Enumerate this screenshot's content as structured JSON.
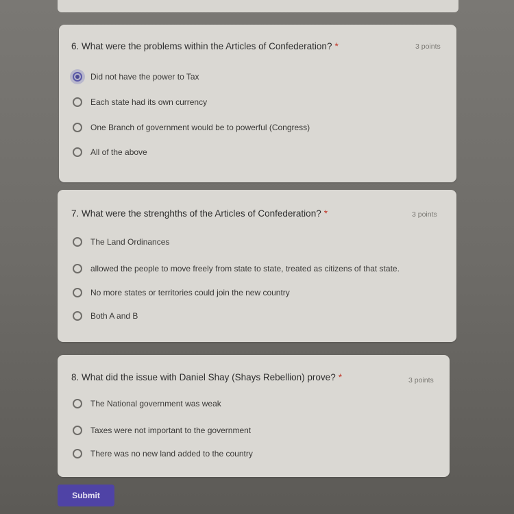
{
  "questions": [
    {
      "title": "6. What were the problems within the Articles of Confederation?",
      "required": "*",
      "points": "3 points",
      "options": [
        {
          "label": "Did not have the power to Tax",
          "checked": true
        },
        {
          "label": "Each state had its own currency",
          "checked": false
        },
        {
          "label": "One Branch of government would be to powerful (Congress)",
          "checked": false
        },
        {
          "label": "All of the above",
          "checked": false
        }
      ]
    },
    {
      "title": "7. What were the strenghths of the Articles of Confederation?",
      "required": "*",
      "points": "3 points",
      "options": [
        {
          "label": "The Land Ordinances",
          "checked": false
        },
        {
          "label": "allowed the people to move freely from state to state, treated as citizens of that state.",
          "checked": false
        },
        {
          "label": "No more states or territories could join the new country",
          "checked": false
        },
        {
          "label": "Both A and B",
          "checked": false
        }
      ]
    },
    {
      "title": "8. What did the issue with Daniel Shay (Shays Rebellion) prove?",
      "required": "*",
      "points": "3 points",
      "options": [
        {
          "label": "The National government was weak",
          "checked": false
        },
        {
          "label": "Taxes were not important to the government",
          "checked": false
        },
        {
          "label": "There was no new land added to the country",
          "checked": false
        }
      ]
    }
  ],
  "submit_label": "Submit"
}
